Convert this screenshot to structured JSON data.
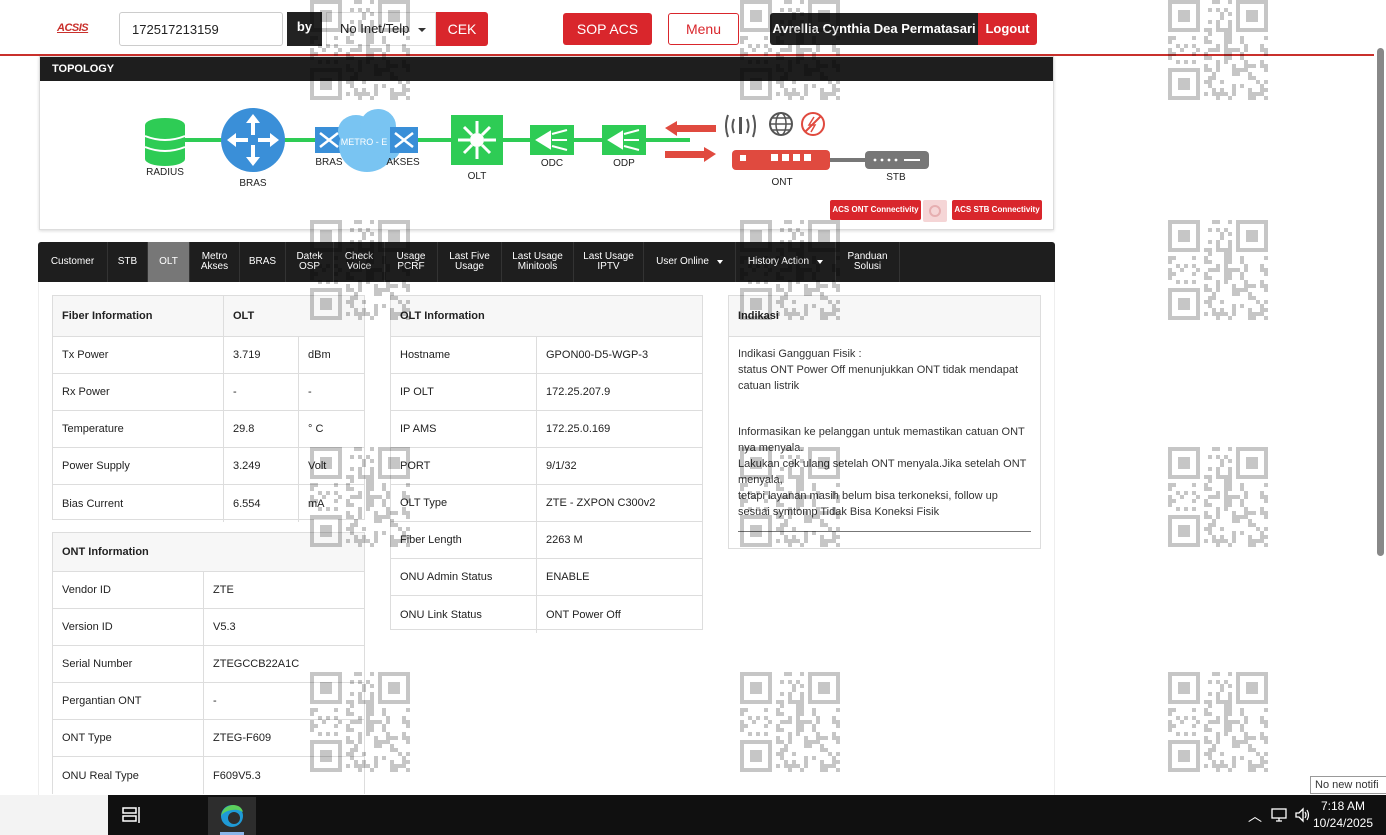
{
  "header": {
    "logo": "ACSIS",
    "search_value": "172517213159",
    "by_label": "by",
    "search_type": "No Inet/Telp",
    "cek_label": "CEK",
    "sop_label": "SOP ACS",
    "menu_label": "Menu",
    "user_name": "Avrellia Cynthia Dea Permatasari",
    "logout_label": "Logout"
  },
  "topology": {
    "title": "TOPOLOGY",
    "nodes": {
      "radius": "RADIUS",
      "bras": "BRAS",
      "bras2": "BRAS",
      "metro": "METRO - E",
      "akses": "AKSES",
      "olt": "OLT",
      "odc": "ODC",
      "odp": "ODP",
      "ont": "ONT",
      "stb": "STB"
    },
    "acs_ont_label": "ACS ONT Connectivity",
    "acs_stb_label": "ACS STB Connectivity"
  },
  "tabs": [
    {
      "label": "Customer"
    },
    {
      "label": "STB"
    },
    {
      "label": "OLT",
      "active": true
    },
    {
      "label": "Metro\nAkses"
    },
    {
      "label": "BRAS"
    },
    {
      "label": "Datek\nOSP"
    },
    {
      "label": "Check\nVoice"
    },
    {
      "label": "Usage\nPCRF"
    },
    {
      "label": "Last Five\nUsage"
    },
    {
      "label": "Last Usage\nMinitools"
    },
    {
      "label": "Last Usage\nIPTV"
    },
    {
      "label": "User Online",
      "dropdown": true
    },
    {
      "label": "History Action",
      "dropdown": true
    },
    {
      "label": "Panduan\nSolusi"
    }
  ],
  "fiber": {
    "header": [
      "Fiber Information",
      "OLT"
    ],
    "rows": [
      [
        "Tx Power",
        "3.719",
        "dBm"
      ],
      [
        "Rx Power",
        "-",
        "-"
      ],
      [
        "Temperature",
        "29.8",
        "° C"
      ],
      [
        "Power Supply",
        "3.249",
        "Volt"
      ],
      [
        "Bias Current",
        "6.554",
        "mA"
      ]
    ]
  },
  "ont": {
    "header": "ONT Information",
    "rows": [
      [
        "Vendor ID",
        "ZTE"
      ],
      [
        "Version ID",
        "V5.3"
      ],
      [
        "Serial Number",
        "ZTEGCCB22A1C"
      ],
      [
        "Pergantian ONT",
        "-"
      ],
      [
        "ONT Type",
        "ZTEG-F609"
      ],
      [
        "ONU Real Type",
        "F609V5.3"
      ]
    ]
  },
  "olt_info": {
    "header": "OLT Information",
    "rows": [
      [
        "Hostname",
        "GPON00-D5-WGP-3"
      ],
      [
        "IP OLT",
        "172.25.207.9"
      ],
      [
        "IP AMS",
        "172.25.0.169"
      ],
      [
        "PORT",
        "9/1/32"
      ],
      [
        "OLT Type",
        "ZTE - ZXPON C300v2"
      ],
      [
        "Fiber Length",
        "2263 M"
      ],
      [
        "ONU Admin Status",
        "ENABLE"
      ],
      [
        "ONU Link Status",
        "ONT Power Off"
      ]
    ]
  },
  "indikasi": {
    "header": "Indikasi",
    "lines": [
      "Indikasi Gangguan Fisik :",
      "status ONT Power Off menunjukkan ONT tidak mendapat catuan listrik",
      "",
      "",
      "Informasikan ke pelanggan untuk memastikan catuan ONT nya menyala.",
      "Lakukan cek ulang setelah ONT menyala.Jika setelah ONT menyala,",
      "tetapi layanan masih belum bisa terkoneksi, follow up sesuai symtomp Tidak Bisa Koneksi Fisik"
    ]
  },
  "system": {
    "notification": "No new notifi",
    "time": "7:18 AM",
    "date": "10/24/2025"
  },
  "colors": {
    "accent_red": "#d9262c",
    "dark": "#1e1e1e",
    "topo_blue": "#3a8fd8",
    "topo_green": "#2ecc55"
  }
}
